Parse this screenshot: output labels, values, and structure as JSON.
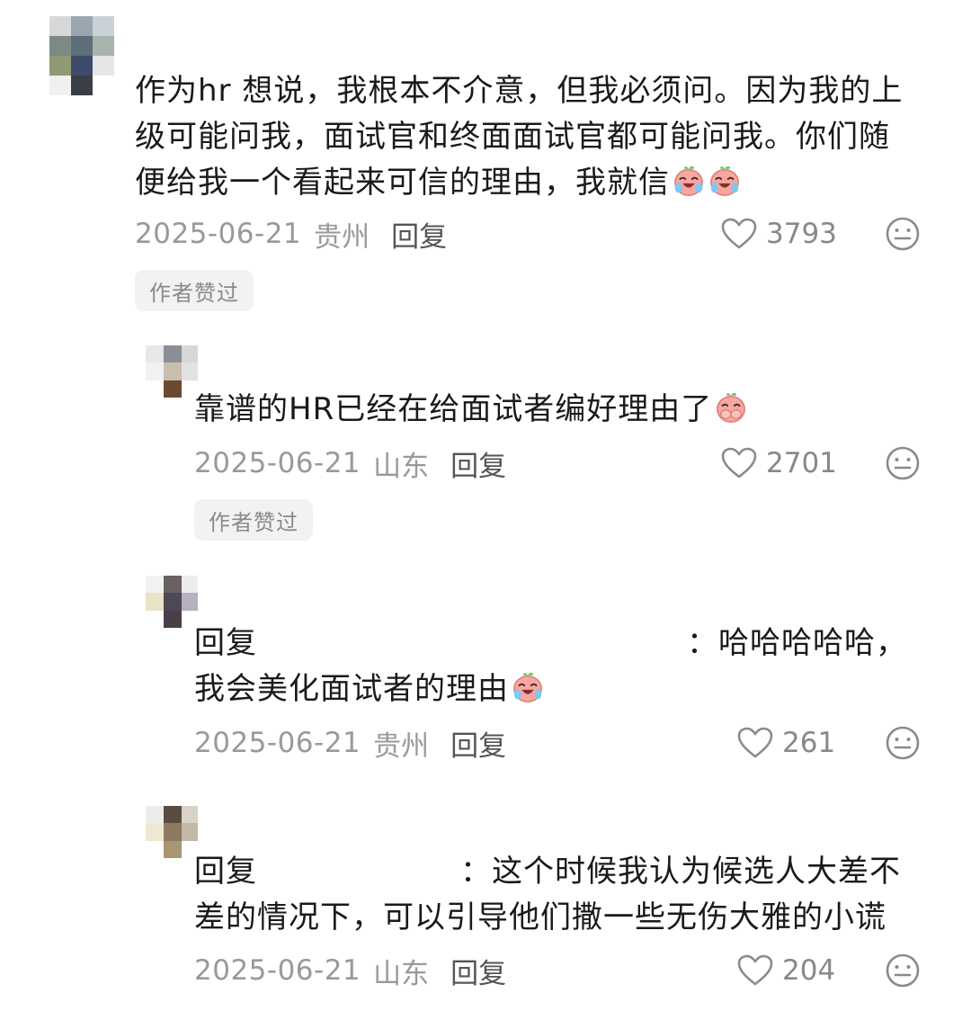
{
  "comments": [
    {
      "text": "作为hr 想说，我根本不介意，但我必须问。因为我的上级可能问我，面试官和终面面试官都可能问我。你们随便给我一个看起来可信的理由，我就信",
      "text_line1": "作为hr 想说，我根本不介意，但我必须问。因为我的上",
      "text_line2": "级可能问我，面试官和终面面试官都可能问我。你们随",
      "text_line3": "便给我一个看起来可信的理由，我就信",
      "emojis": [
        "crying-laugh-icon",
        "crying-laugh-icon"
      ],
      "date": "2025-06-21",
      "location": "贵州",
      "reply_label": "回复",
      "likes": "3793",
      "badge": "作者赞过"
    },
    {
      "text": "靠谱的HR已经在给面试者编好理由了",
      "emojis": [
        "cover-mouth-laugh-icon"
      ],
      "date": "2025-06-21",
      "location": "山东",
      "reply_label": "回复",
      "likes": "2701",
      "badge": "作者赞过"
    },
    {
      "prefix": "回复",
      "separator": "：",
      "text_line1": "哈哈哈哈哈，",
      "text_line2": "我会美化面试者的理由",
      "emojis": [
        "crying-laugh-icon"
      ],
      "date": "2025-06-21",
      "location": "贵州",
      "reply_label": "回复",
      "likes": "261"
    },
    {
      "prefix": "回复",
      "separator": "：",
      "text_line1": "这个时候我认为候选人大差不",
      "text_line2": "差的情况下，可以引导他们撒一些无伤大雅的小谎",
      "date": "2025-06-21",
      "location": "山东",
      "reply_label": "回复",
      "likes": "204"
    }
  ],
  "colors": {
    "meta_text": "#999999",
    "reply_text": "#555555",
    "badge_bg": "#f2f2f2",
    "badge_text": "#8a8a8a",
    "emoji_face": "#f7a6a0"
  }
}
